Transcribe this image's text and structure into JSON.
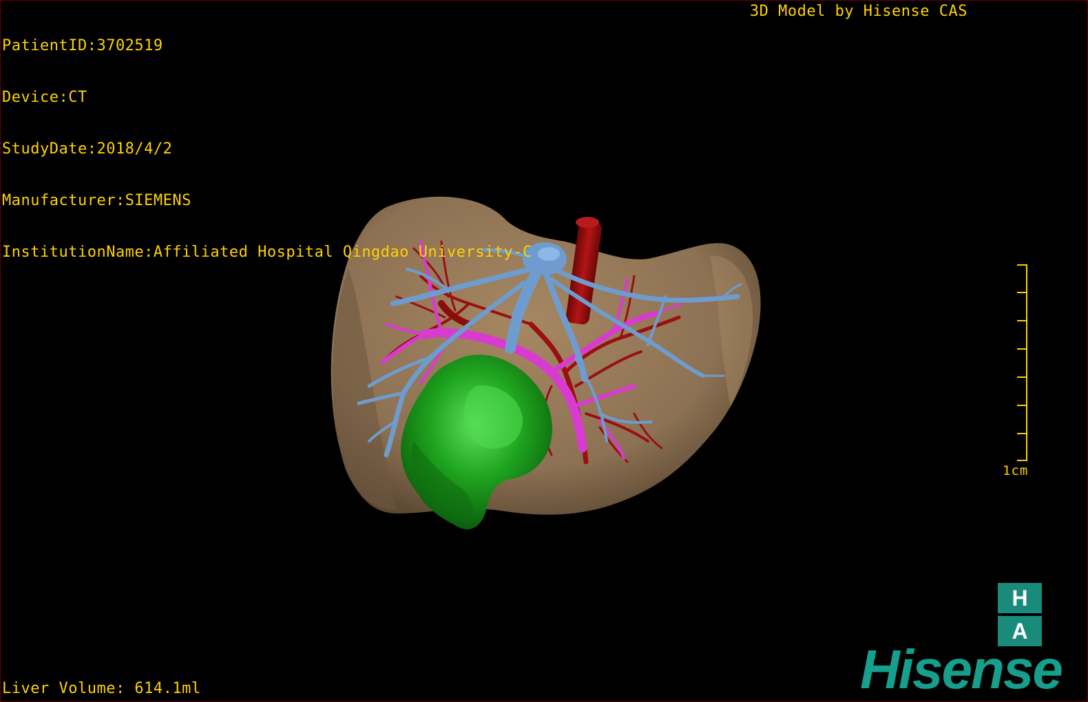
{
  "patient_info": {
    "patient_id": "PatientID:3702519",
    "device": "Device:CT",
    "study_date": "StudyDate:2018/4/2",
    "manufacturer": "Manufacturer:SIEMENS",
    "institution": "InstitutionName:Affiliated Hospital Qingdao University-C"
  },
  "model_credit": "3D Model by Hisense CAS",
  "liver_volume": "Liver Volume: 614.1ml",
  "scale": {
    "label": "1cm"
  },
  "logo": {
    "ha_top": "H",
    "ha_bottom": "A",
    "brand": "Hisense"
  },
  "colors": {
    "overlay_text": "#ffd200",
    "liver": "#8c7153",
    "hepatic_vein": "#6f9ccf",
    "portal_vein": "#d93bd1",
    "hepatic_artery": "#9a0f0f",
    "tumor": "#1fa51f",
    "brand": "#159f8c"
  }
}
